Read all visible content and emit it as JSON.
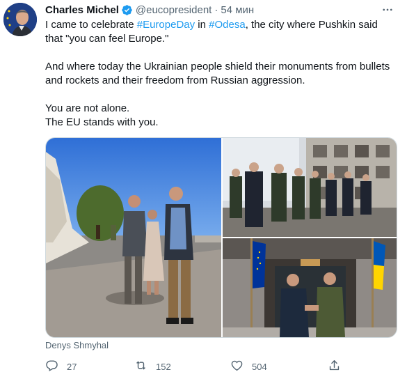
{
  "author": {
    "name": "Charles Michel",
    "handle": "@eucopresident",
    "separator": "·",
    "time": "54 мин",
    "verified": true
  },
  "tweet": {
    "line1_pre": "I came to celebrate ",
    "line1_tag1": "#EuropeDay",
    "line1_mid": " in ",
    "line1_tag2": "#Odesa",
    "line1_post": ", the city where Pushkin said",
    "line2": "that \"you can feel Europe.\"",
    "line3": "And where today the Ukrainian people shield their monuments from bullets",
    "line4": "and rockets and their freedom from Russian aggression.",
    "line5": "You are not alone.",
    "line6": "The EU stands with you."
  },
  "media": {
    "caption": "Denys Shmyhal",
    "photos": [
      "outdoor-meeting-photo",
      "walking-delegation-photo",
      "handshake-flags-photo"
    ]
  },
  "actions": {
    "replies": "27",
    "retweets": "152",
    "likes": "504"
  },
  "icons": {
    "more": "more-dots-icon",
    "reply": "reply-icon",
    "retweet": "retweet-icon",
    "like": "heart-icon",
    "share": "share-icon",
    "verified": "verified-badge-icon"
  },
  "colors": {
    "link": "#1d9bf0",
    "muted": "#536471",
    "text": "#0f1419",
    "eu_blue": "#003399",
    "ukraine_yellow": "#ffd500"
  }
}
